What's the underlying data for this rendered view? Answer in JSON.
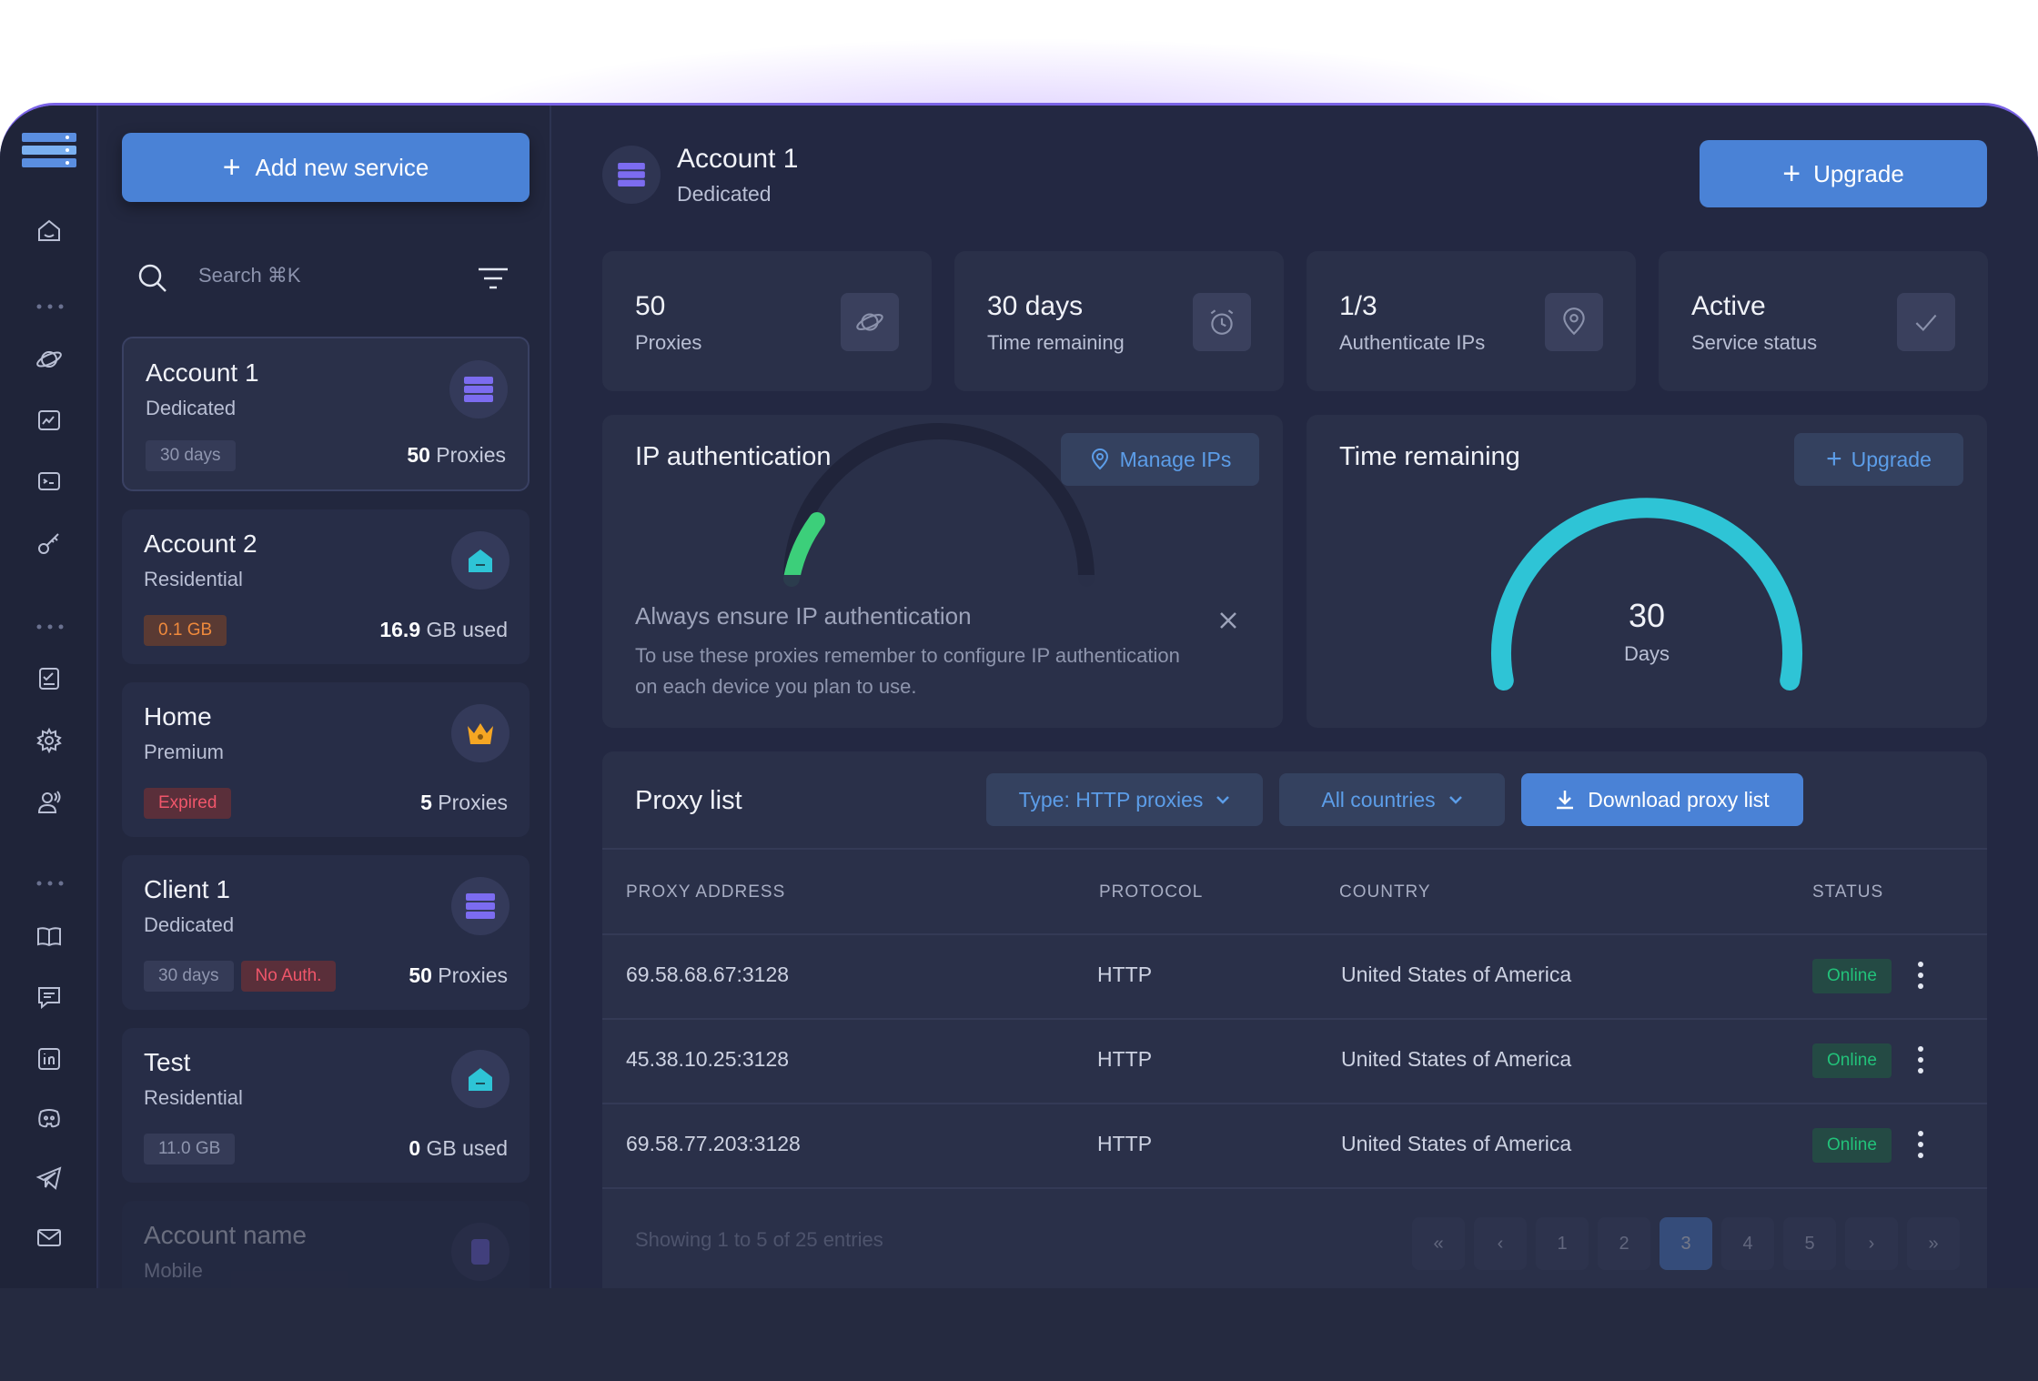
{
  "sidebar": {
    "add_button": "Add new service",
    "search_placeholder": "Search ⌘K",
    "accounts": [
      {
        "name": "Account 1",
        "type": "Dedicated",
        "tags": [
          "30 days"
        ],
        "stat_value": "50",
        "stat_unit": "Proxies"
      },
      {
        "name": "Account 2",
        "type": "Residential",
        "tags": [
          "0.1 GB"
        ],
        "stat_value": "16.9",
        "stat_unit": "GB used"
      },
      {
        "name": "Home",
        "type": "Premium",
        "tags": [
          "Expired"
        ],
        "stat_value": "5",
        "stat_unit": "Proxies"
      },
      {
        "name": "Client 1",
        "type": "Dedicated",
        "tags": [
          "30 days",
          "No Auth."
        ],
        "stat_value": "50",
        "stat_unit": "Proxies"
      },
      {
        "name": "Test",
        "type": "Residential",
        "tags": [
          "11.0 GB"
        ],
        "stat_value": "0",
        "stat_unit": "GB used"
      },
      {
        "name": "Account name",
        "type": "Mobile"
      }
    ]
  },
  "header": {
    "title": "Account 1",
    "subtitle": "Dedicated",
    "upgrade_button": "Upgrade"
  },
  "stats": [
    {
      "value": "50",
      "label": "Proxies",
      "icon": "planet-icon"
    },
    {
      "value": "30 days",
      "label": "Time remaining",
      "icon": "alarm-clock-icon"
    },
    {
      "value": "1/3",
      "label": "Authenticate IPs",
      "icon": "location-pin-icon"
    },
    {
      "value": "Active",
      "label": "Service status",
      "icon": "check-icon"
    }
  ],
  "ip_auth": {
    "title": "IP authentication",
    "manage_button": "Manage IPs",
    "notice_title": "Always ensure IP authentication",
    "notice_text": "To use these proxies remember to configure IP authentication on each device you plan to use."
  },
  "time_remaining": {
    "title": "Time remaining",
    "upgrade_button": "Upgrade",
    "value": "30",
    "unit": "Days",
    "fraction": 1.0,
    "color": "#2ec4d6"
  },
  "proxy_list": {
    "title": "Proxy list",
    "type_filter": "Type: HTTP proxies",
    "country_filter": "All countries",
    "download_button": "Download proxy list",
    "columns": [
      "PROXY ADDRESS",
      "PROTOCOL",
      "COUNTRY",
      "STATUS"
    ],
    "rows": [
      {
        "address": "69.58.68.67:3128",
        "protocol": "HTTP",
        "country": "United States of America",
        "status": "Online"
      },
      {
        "address": "45.38.10.25:3128",
        "protocol": "HTTP",
        "country": "United States of America",
        "status": "Online"
      },
      {
        "address": "69.58.77.203:3128",
        "protocol": "HTTP",
        "country": "United States of America",
        "status": "Online"
      }
    ],
    "pagination": {
      "info": "Showing 1 to 5 of 25 entries",
      "pages": [
        "1",
        "2",
        "3",
        "4",
        "5"
      ],
      "current": "3",
      "first": "«",
      "prev": "‹",
      "next": "›",
      "last": "»"
    }
  },
  "colors": {
    "accent": "#4a82d6",
    "online": "#22c27a",
    "expired": "#f0566a",
    "warning": "#f08a3c"
  }
}
